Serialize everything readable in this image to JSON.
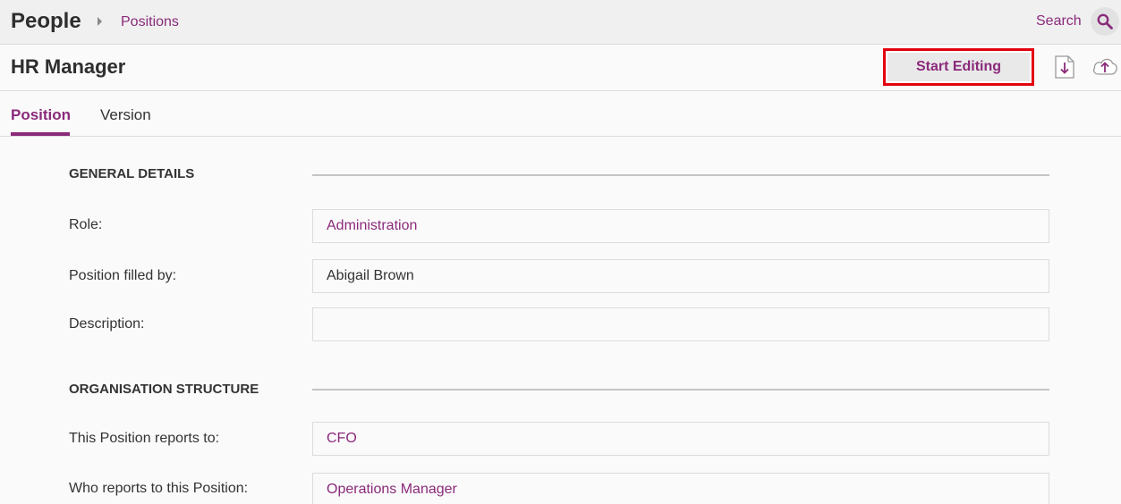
{
  "header": {
    "app_title": "People",
    "breadcrumb": "Positions",
    "search_label": "Search",
    "search_icon": "magnifier"
  },
  "titlebar": {
    "page_title": "HR Manager",
    "start_editing_label": "Start Editing",
    "download_icon": "document-download",
    "upload_icon": "cloud-upload"
  },
  "tabs": [
    {
      "label": "Position",
      "active": true
    },
    {
      "label": "Version",
      "active": false
    }
  ],
  "general_details": {
    "heading": "GENERAL DETAILS",
    "role": {
      "label": "Role:",
      "value": "Administration"
    },
    "filled_by": {
      "label": "Position filled by:",
      "value": "Abigail Brown"
    },
    "description": {
      "label": "Description:",
      "value": ""
    }
  },
  "org_structure": {
    "heading": "ORGANISATION STRUCTURE",
    "reports_to": {
      "label": "This Position reports to:",
      "value": "CFO"
    },
    "who_reports": {
      "label": "Who reports to this Position:",
      "value": "Operations Manager"
    }
  },
  "colors": {
    "accent": "#8a2a7a",
    "highlight": "#e3000f"
  }
}
